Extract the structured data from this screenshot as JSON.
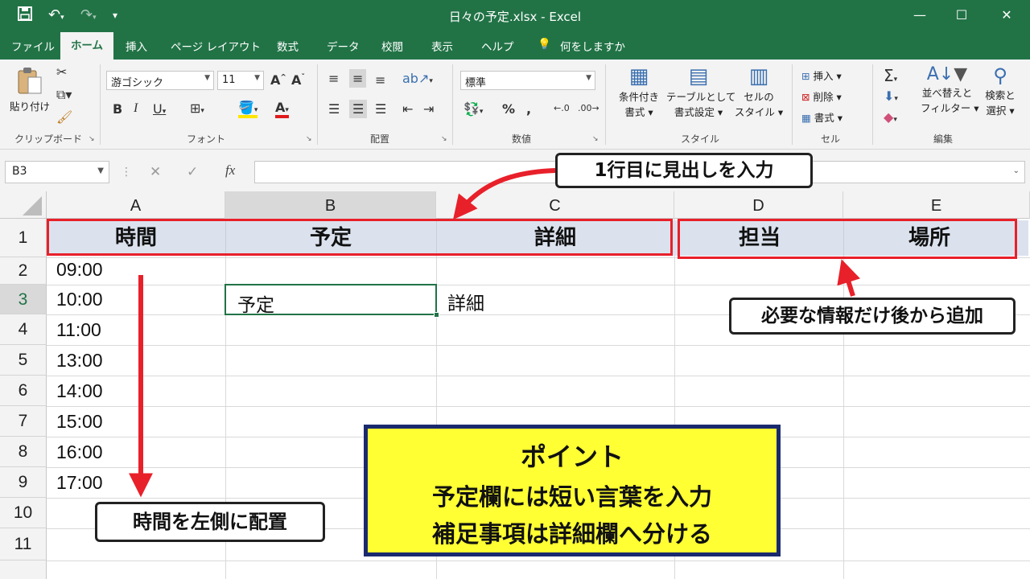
{
  "window": {
    "title": "日々の予定.xlsx  -  Excel",
    "min_icon": "minimize-icon",
    "max_icon": "maximize-icon",
    "close_icon": "close-icon"
  },
  "tabs": [
    {
      "label": "ファイル"
    },
    {
      "label": "ホーム"
    },
    {
      "label": "挿入"
    },
    {
      "label": "ページ レイアウト"
    },
    {
      "label": "数式"
    },
    {
      "label": "データ"
    },
    {
      "label": "校閲"
    },
    {
      "label": "表示"
    },
    {
      "label": "ヘルプ"
    }
  ],
  "tell_me": "何をしますか",
  "ribbon": {
    "clipboard": {
      "paste": "貼り付け",
      "group": "クリップボード"
    },
    "font": {
      "name": "游ゴシック",
      "size": "11",
      "group": "フォント"
    },
    "alignment": {
      "group": "配置"
    },
    "number": {
      "format": "標準",
      "group": "数値"
    },
    "styles": {
      "conditional": [
        "条件付き",
        "書式 ▾"
      ],
      "table": [
        "テーブルとして",
        "書式設定 ▾"
      ],
      "cell": [
        "セルの",
        "スタイル ▾"
      ],
      "group": "スタイル"
    },
    "cells": {
      "insert": "挿入",
      "delete": "削除",
      "format": "書式",
      "group": "セル"
    },
    "editing": {
      "sort": [
        "並べ替えと",
        "フィルター ▾"
      ],
      "find": [
        "検索と",
        "選択 ▾"
      ],
      "group": "編集"
    }
  },
  "formula_bar": {
    "name_box": "B3",
    "fx": "fx",
    "value": ""
  },
  "columns": [
    "A",
    "B",
    "C",
    "D",
    "E"
  ],
  "rows": [
    "1",
    "2",
    "3",
    "4",
    "5",
    "6",
    "7",
    "8",
    "9",
    "10",
    "11"
  ],
  "headers": {
    "a": "時間",
    "b": "予定",
    "c": "詳細",
    "d": "担当",
    "e": "場所"
  },
  "times": [
    "09:00",
    "10:00",
    "11:00",
    "13:00",
    "14:00",
    "15:00",
    "16:00",
    "17:00"
  ],
  "cells": {
    "b3": "予定",
    "c3": "詳細"
  },
  "annotations": {
    "header_callout": "1行目に見出しを入力",
    "optional_callout": "必要な情報だけ後から追加",
    "time_callout": "時間を左側に配置",
    "point_title": "ポイント",
    "point_line1": "予定欄には短い言葉を入力",
    "point_line2": "補足事項は詳細欄へ分ける"
  },
  "colors": {
    "excel_green": "#217346",
    "highlight_red": "#e8202a",
    "point_yellow": "#ffff33",
    "point_border": "#1a2a6e"
  }
}
